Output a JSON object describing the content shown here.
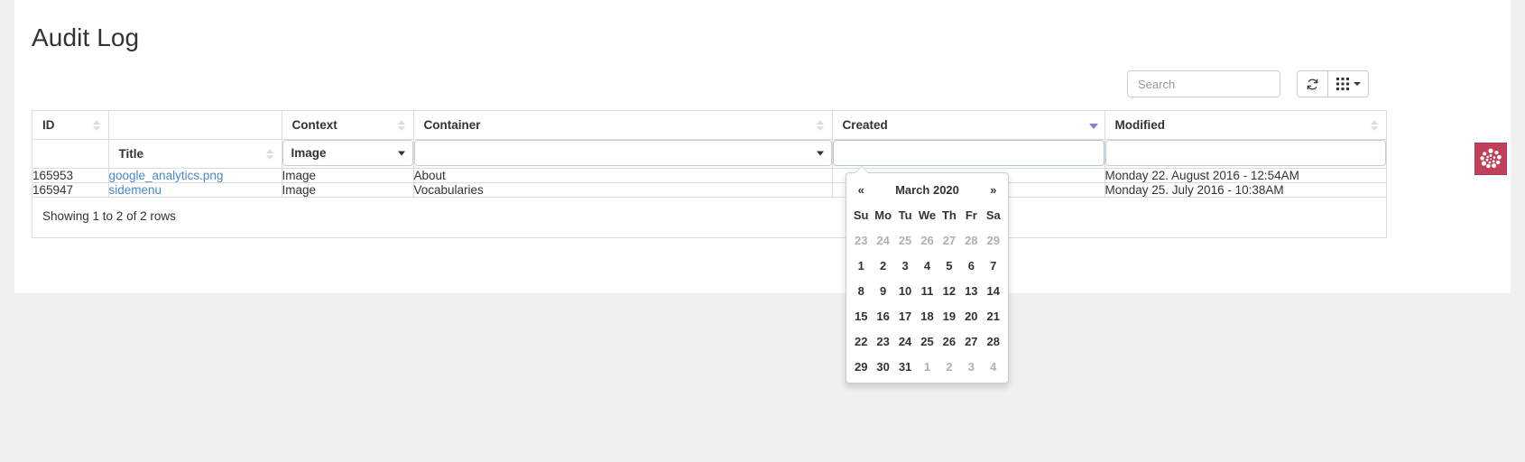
{
  "page": {
    "title": "Audit Log"
  },
  "toolbar": {
    "search_placeholder": "Search",
    "search_value": "",
    "refresh_icon": "refresh-icon",
    "columns_icon": "grid-columns-icon"
  },
  "badge": {
    "icon": "dotted-spiral-icon",
    "color": "#c0405a"
  },
  "table": {
    "columns": [
      {
        "label": "ID",
        "sort": "both"
      },
      {
        "label": "Title",
        "sort": "both"
      },
      {
        "label": "Context",
        "sort": "both"
      },
      {
        "label": "Container",
        "sort": "both"
      },
      {
        "label": "Created",
        "sort": "desc-active"
      },
      {
        "label": "Modified",
        "sort": "both"
      }
    ],
    "filters": {
      "id": "",
      "title": "",
      "context_value": "Image",
      "container_value": "",
      "created_value": "",
      "modified_value": ""
    },
    "rows": [
      {
        "id": "165953",
        "title": "google_analytics.png",
        "context": "Image",
        "container": "About",
        "created": "",
        "modified": "Monday 22. August 2016 - 12:54AM"
      },
      {
        "id": "165947",
        "title": "sidemenu",
        "context": "Image",
        "container": "Vocabularies",
        "created": "",
        "modified": "Monday 25. July 2016 - 10:38AM"
      }
    ],
    "footer": "Showing 1 to 2 of 2 rows"
  },
  "datepicker": {
    "prev_label": "«",
    "next_label": "»",
    "month_title": "March 2020",
    "dow": [
      "Su",
      "Mo",
      "Tu",
      "We",
      "Th",
      "Fr",
      "Sa"
    ],
    "weeks": [
      [
        {
          "d": "23",
          "muted": true
        },
        {
          "d": "24",
          "muted": true
        },
        {
          "d": "25",
          "muted": true
        },
        {
          "d": "26",
          "muted": true
        },
        {
          "d": "27",
          "muted": true
        },
        {
          "d": "28",
          "muted": true
        },
        {
          "d": "29",
          "muted": true
        }
      ],
      [
        {
          "d": "1",
          "muted": false
        },
        {
          "d": "2",
          "muted": false
        },
        {
          "d": "3",
          "muted": false
        },
        {
          "d": "4",
          "muted": false
        },
        {
          "d": "5",
          "muted": false
        },
        {
          "d": "6",
          "muted": false
        },
        {
          "d": "7",
          "muted": false
        }
      ],
      [
        {
          "d": "8",
          "muted": false
        },
        {
          "d": "9",
          "muted": false
        },
        {
          "d": "10",
          "muted": false
        },
        {
          "d": "11",
          "muted": false
        },
        {
          "d": "12",
          "muted": false
        },
        {
          "d": "13",
          "muted": false
        },
        {
          "d": "14",
          "muted": false
        }
      ],
      [
        {
          "d": "15",
          "muted": false
        },
        {
          "d": "16",
          "muted": false
        },
        {
          "d": "17",
          "muted": false
        },
        {
          "d": "18",
          "muted": false
        },
        {
          "d": "19",
          "muted": false
        },
        {
          "d": "20",
          "muted": false
        },
        {
          "d": "21",
          "muted": false
        }
      ],
      [
        {
          "d": "22",
          "muted": false
        },
        {
          "d": "23",
          "muted": false
        },
        {
          "d": "24",
          "muted": false
        },
        {
          "d": "25",
          "muted": false
        },
        {
          "d": "26",
          "muted": false
        },
        {
          "d": "27",
          "muted": false
        },
        {
          "d": "28",
          "muted": false
        }
      ],
      [
        {
          "d": "29",
          "muted": false
        },
        {
          "d": "30",
          "muted": false
        },
        {
          "d": "31",
          "muted": false
        },
        {
          "d": "1",
          "muted": true
        },
        {
          "d": "2",
          "muted": true
        },
        {
          "d": "3",
          "muted": true
        },
        {
          "d": "4",
          "muted": true
        }
      ]
    ]
  }
}
